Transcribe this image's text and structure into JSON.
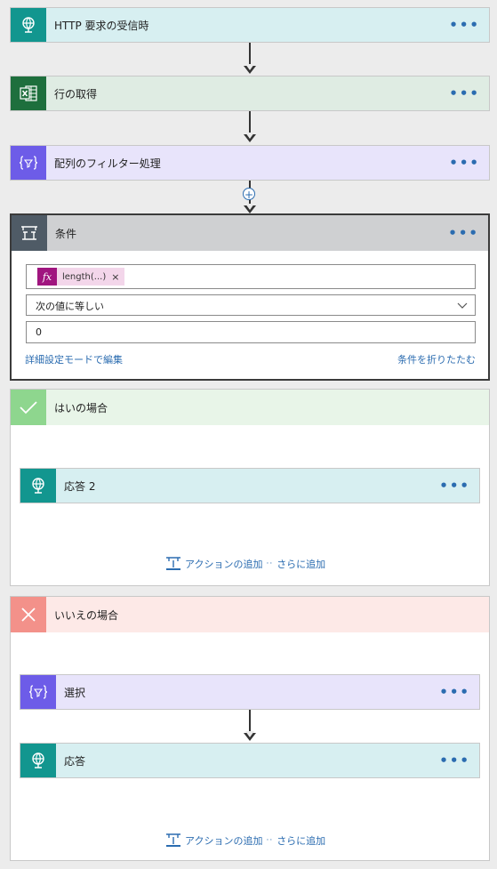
{
  "steps": {
    "http_trigger": {
      "title": "HTTP 要求の受信時",
      "icon": "globe-icon"
    },
    "get_rows": {
      "title": "行の取得",
      "icon": "excel-icon"
    },
    "filter_array": {
      "title": "配列のフィルター処理",
      "icon": "filter-icon"
    }
  },
  "more_label": "•••",
  "insert_step": "+",
  "condition": {
    "title": "条件",
    "token_icon": "fx",
    "token_label": "length(...)",
    "token_remove": "×",
    "operator": "次の値に等しい",
    "value": "0",
    "advanced_link": "詳細設定モードで編集",
    "collapse_link": "条件を折りたたむ"
  },
  "yes_branch": {
    "title": "はいの場合",
    "actions": [
      {
        "title": "応答 2",
        "icon": "globe-icon"
      }
    ],
    "add_action": "アクションの追加",
    "add_more": "さらに追加"
  },
  "no_branch": {
    "title": "いいえの場合",
    "actions": [
      {
        "title": "選択",
        "icon": "filter-icon"
      },
      {
        "title": "応答",
        "icon": "globe-icon"
      }
    ],
    "add_action": "アクションの追加",
    "add_more": "さらに追加"
  },
  "colors": {
    "teal": "#12968f",
    "excel_green": "#1e6f3d",
    "purple": "#6d5ce8",
    "yes_green": "#8ed68e",
    "no_red": "#f3918a",
    "link_blue": "#2b6cb0"
  }
}
